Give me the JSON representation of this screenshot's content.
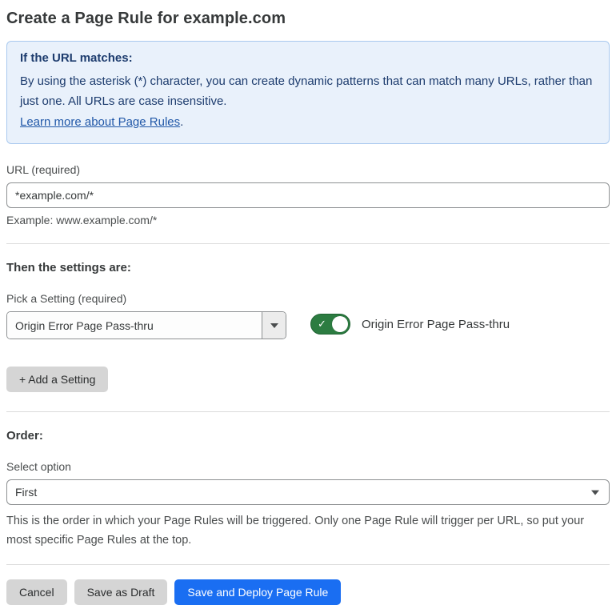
{
  "page": {
    "title": "Create a Page Rule for example.com"
  },
  "info_box": {
    "heading": "If the URL matches:",
    "body": "By using the asterisk (*) character, you can create dynamic patterns that can match many URLs, rather than just one. All URLs are case insensitive.",
    "link_label": "Learn more about Page Rules",
    "link_suffix": "."
  },
  "url_field": {
    "label": "URL (required)",
    "value": "*example.com/*",
    "helper": "Example: www.example.com/*"
  },
  "settings_section": {
    "heading": "Then the settings are:",
    "picker_label": "Pick a Setting (required)",
    "picker_value": "Origin Error Page Pass-thru",
    "toggle_label": "Origin Error Page Pass-thru",
    "toggle_state": "on",
    "toggle_check_glyph": "✓",
    "add_button_label": "+ Add a Setting"
  },
  "order_section": {
    "heading": "Order:",
    "select_label": "Select option",
    "select_value": "First",
    "helper": "This is the order in which your Page Rules will be triggered. Only one Page Rule will trigger per URL, so put your most specific Page Rules at the top."
  },
  "footer": {
    "cancel_label": "Cancel",
    "save_draft_label": "Save as Draft",
    "save_deploy_label": "Save and Deploy Page Rule"
  },
  "colors": {
    "accent_blue": "#1a6ef2",
    "toggle_green": "#2c7c41",
    "info_background": "#e9f1fb",
    "info_border": "#a9c9ef",
    "info_text": "#1d3c6e",
    "link_blue": "#2158a8"
  }
}
